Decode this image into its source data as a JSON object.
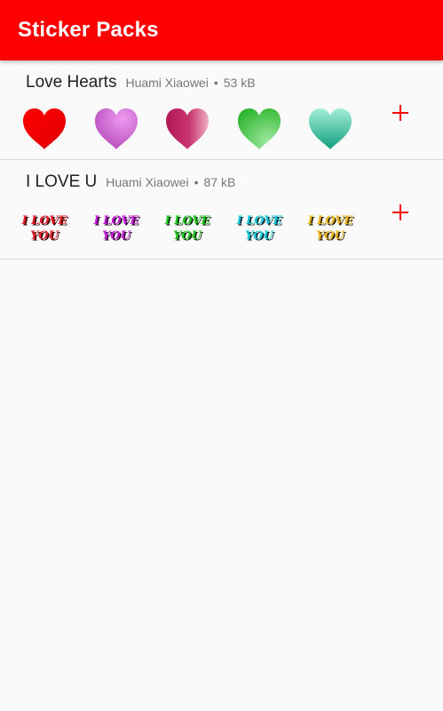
{
  "app_bar": {
    "title": "Sticker Packs",
    "color": "#ff0000"
  },
  "packs": [
    {
      "name": "Love Hearts",
      "author": "Huami Xiaowei",
      "separator": "•",
      "size": "53 kB",
      "add_icon": "plus-icon",
      "stickers": [
        {
          "icon": "red-heart-icon",
          "colors": [
            "#ff0000",
            "#e00000"
          ]
        },
        {
          "icon": "purple-heart-icon",
          "colors": [
            "#ee9af0",
            "#b54bbb"
          ]
        },
        {
          "icon": "crimson-heart-icon",
          "colors": [
            "#b31757",
            "#f0b0c4"
          ]
        },
        {
          "icon": "green-heart-icon",
          "colors": [
            "#2db52d",
            "#9ee79e"
          ]
        },
        {
          "icon": "teal-heart-icon",
          "colors": [
            "#109e7e",
            "#a4efd9"
          ]
        }
      ]
    },
    {
      "name": "I LOVE U",
      "author": "Huami Xiaowei",
      "separator": "•",
      "size": "87 kB",
      "add_icon": "plus-icon",
      "stickers": [
        {
          "icon": "i-love-you-red-icon",
          "line1": "I LOVE",
          "line2": "YOU",
          "color": "#e0202a"
        },
        {
          "icon": "i-love-you-purple-icon",
          "line1": "I LOVE",
          "line2": "YOU",
          "color": "#c21bd6"
        },
        {
          "icon": "i-love-you-green-icon",
          "line1": "I LOVE",
          "line2": "YOU",
          "color": "#21c321"
        },
        {
          "icon": "i-love-you-cyan-icon",
          "line1": "I LOVE",
          "line2": "YOU",
          "color": "#19c6d9"
        },
        {
          "icon": "i-love-you-gold-icon",
          "line1": "I LOVE",
          "line2": "YOU",
          "color": "#e8b21c"
        }
      ]
    }
  ]
}
